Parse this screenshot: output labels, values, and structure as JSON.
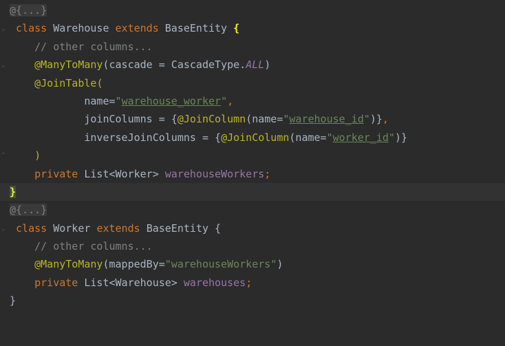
{
  "code": {
    "fold1": "@{...}",
    "l2": {
      "kw_class": "class",
      "name": "Warehouse",
      "kw_extends": "extends",
      "base": "BaseEntity",
      "brace": "{"
    },
    "l3": {
      "comment": "// other columns..."
    },
    "l4": {
      "ann": "@ManyToMany",
      "open": "(cascade = CascadeType.",
      "const": "ALL",
      "close": ")"
    },
    "l5": {
      "ann": "@JoinTable",
      "open": "("
    },
    "l6": {
      "prefix": "name=",
      "q1": "\"",
      "str": "warehouse_worker",
      "q2": "\"",
      "tail": ","
    },
    "l7": {
      "prefix": "joinColumns = {",
      "ann": "@JoinColumn",
      "mid": "(name=",
      "q1": "\"",
      "str": "warehouse_id",
      "q2": "\"",
      "tail": ")}",
      "comma": ","
    },
    "l8": {
      "prefix": "inverseJoinColumns = {",
      "ann": "@JoinColumn",
      "mid": "(name=",
      "q1": "\"",
      "str": "worker_id",
      "q2": "\"",
      "tail": ")}"
    },
    "l9": {
      "text": ")"
    },
    "l10": {
      "kw": "private",
      "type": "List<Worker>",
      "field": "warehouseWorkers",
      "semi": ";"
    },
    "l11": {
      "brace": "}"
    },
    "fold2": "@{...}",
    "l13": {
      "kw_class": "class",
      "name": "Worker",
      "kw_extends": "extends",
      "base": "BaseEntity",
      "brace": "{"
    },
    "l14": {
      "comment": "// other columns..."
    },
    "l15": {
      "ann": "@ManyToMany",
      "open": "(mappedBy=",
      "str": "\"warehouseWorkers\"",
      "close": ")"
    },
    "l16": {
      "kw": "private",
      "type": "List<Warehouse>",
      "field": "warehouses",
      "semi": ";"
    },
    "l17": {
      "brace": "}"
    }
  },
  "colors": {
    "background": "#2b2b2b",
    "current_line": "#323232",
    "keyword": "#cc7832",
    "annotation": "#bbb529",
    "string": "#6a8759",
    "comment": "#808080",
    "field": "#9876aa",
    "default_text": "#a9b7c6",
    "brace_highlight": "#ffef28"
  }
}
